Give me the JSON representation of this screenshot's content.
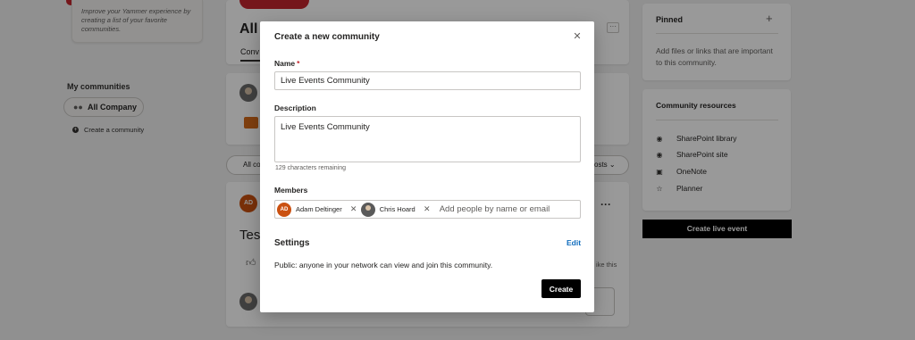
{
  "background": {
    "favorites_tip": "Improve your Yammer experience by creating a list of your favorite communities.",
    "my_communities_title": "My communities",
    "all_company_label": "All Company",
    "create_community_link": "Create a community",
    "community_title": "All",
    "conversations_tab": "Conv",
    "filter_all": "All co",
    "filter_posts": "osts",
    "post_author_initials": "AD",
    "post_text": "Test",
    "like_this_text": "ike this",
    "pinned": {
      "title": "Pinned",
      "description": "Add files or links that are important to this community."
    },
    "resources": {
      "title": "Community resources",
      "items": [
        {
          "label": "SharePoint library",
          "icon": "sharepoint-library-icon"
        },
        {
          "label": "SharePoint site",
          "icon": "sharepoint-site-icon"
        },
        {
          "label": "OneNote",
          "icon": "onenote-icon"
        },
        {
          "label": "Planner",
          "icon": "planner-icon"
        }
      ]
    },
    "create_live_event_label": "Create live event"
  },
  "modal": {
    "title": "Create a new community",
    "name_label": "Name",
    "name_required_marker": "*",
    "name_value": "Live Events Community",
    "description_label": "Description",
    "description_value": "Live Events Community",
    "chars_remaining": "129 characters remaining",
    "members_label": "Members",
    "members": [
      {
        "initials": "AD",
        "name": "Adam Deltinger"
      },
      {
        "initials": "",
        "name": "Chris Hoard"
      }
    ],
    "members_placeholder": "Add people by name or email",
    "settings_title": "Settings",
    "edit_label": "Edit",
    "privacy_text": "Public: anyone in your network can view and join this community.",
    "create_label": "Create"
  },
  "colors": {
    "accent_red": "#c4262e",
    "link_blue": "#0f6cbd",
    "button_black": "#000000"
  }
}
